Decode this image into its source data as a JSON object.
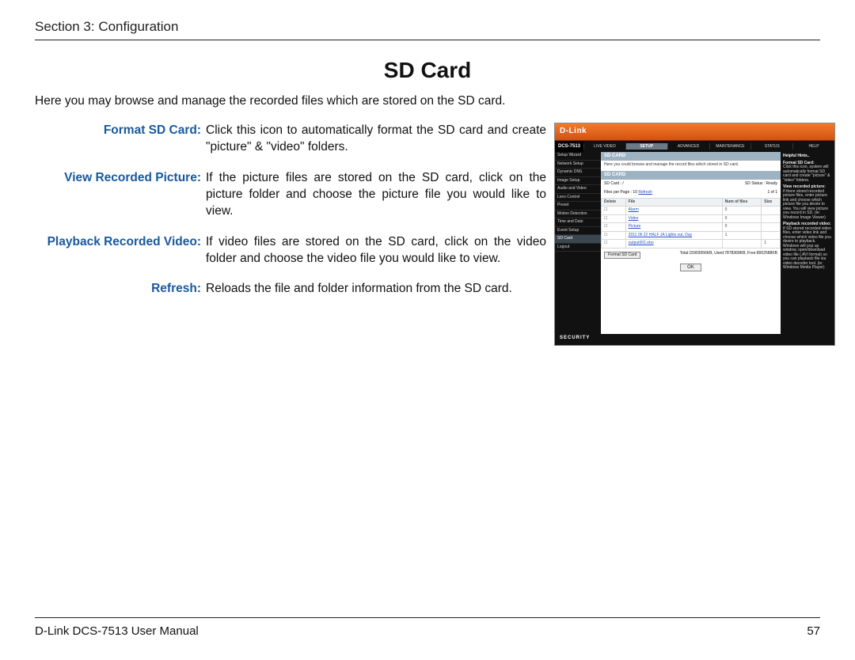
{
  "section_header": "Section 3: Configuration",
  "title": "SD Card",
  "intro": "Here you may browse and manage the recorded files which are stored on the SD card.",
  "definitions": [
    {
      "term": "Format SD Card:",
      "desc": "Click this icon to automatically format the SD card and create \"picture\" & \"video\" folders."
    },
    {
      "term": "View Recorded Picture:",
      "desc": "If the picture files are stored on the SD card, click on the picture folder and choose the picture file you would like to view."
    },
    {
      "term": "Playback Recorded Video:",
      "desc": "If video files are stored on the SD card, click on the video folder and choose the video file you would like to view."
    },
    {
      "term": "Refresh:",
      "desc": "Reloads the file and folder information from the SD card."
    }
  ],
  "screenshot": {
    "brand": "D-Link",
    "model": "DCS-7513",
    "tabs": [
      "LIVE VIDEO",
      "SETUP",
      "ADVANCED",
      "MAINTENANCE",
      "STATUS",
      "HELP"
    ],
    "active_tab": "SETUP",
    "side_menu": [
      "Setup Wizard",
      "Network Setup",
      "Dynamic DNS",
      "Image Setup",
      "Audio and Video",
      "Lens Control",
      "Preset",
      "Motion Detection",
      "Time and Date",
      "Event Setup",
      "SD Card",
      "Logout"
    ],
    "side_menu_active": "SD Card",
    "panel_title": "SD CARD",
    "panel_intro": "Here you could browse and manage the record files which stored in SD card.",
    "panel_sub": "SD CARD",
    "sd_card_label": "SD Card : /",
    "sd_status": "SD Status : Ready",
    "files_per_page_label": "Files per Page :",
    "files_per_page_value": "10",
    "refresh_link": "Refresh",
    "page_indicator": "1  of 1",
    "table_headers": [
      "Delete",
      "File",
      "Num of files",
      "Size"
    ],
    "rows": [
      {
        "file": "Alarm",
        "num": "0",
        "size": ""
      },
      {
        "file": "Video",
        "num": "0",
        "size": ""
      },
      {
        "file": "Picture",
        "num": "0",
        "size": ""
      },
      {
        "file": "2011 06 22 HALF JA Lights out, Day",
        "num": "1",
        "size": ""
      },
      {
        "file": "output001.ebo",
        "num": "",
        "size": "1"
      }
    ],
    "format_btn": "Format SD Card",
    "storage_info": "Total:15903956KB, Used:7878368KB, Free:8002588KB",
    "ok_btn": "OK",
    "help_title": "Helpful Hints..",
    "help_blocks": [
      {
        "h": "Format SD Card:",
        "t": "Click this icon, system will automatically format SD card and create \"picture\" & \"video\" folders."
      },
      {
        "h": "View recorded picture:",
        "t": "If there stored recorded picture files, enter picture link and choose which picture file you desire to view. You will view picture you record in SD. (ie: Windows Image Viewer)"
      },
      {
        "h": "Playback recorded video:",
        "t": "If SD stored recorded video files, enter video link and choose which video file you desire to playback. Windows will pop up window, open/download video file (.AVI format) so you can playback file via video decoder tool. (ie: Windows Media Player)"
      }
    ],
    "security": "SECURITY"
  },
  "footer_left": "D-Link DCS-7513 User Manual",
  "footer_right": "57"
}
